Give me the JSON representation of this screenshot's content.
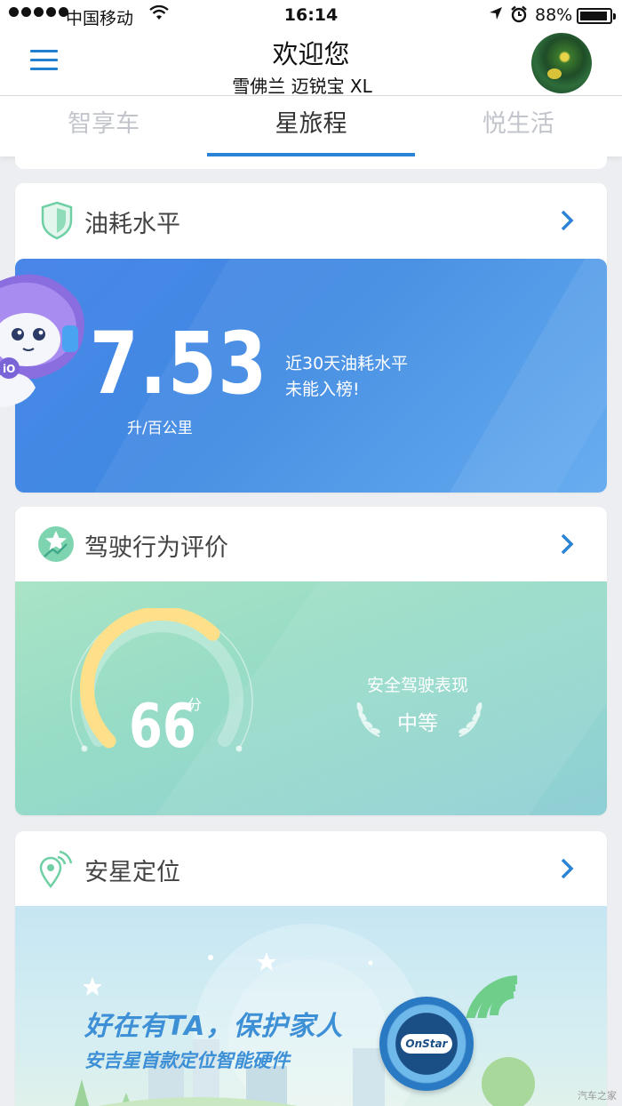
{
  "status_bar": {
    "carrier": "中国移动",
    "time": "16:14",
    "battery_pct": "88%",
    "battery_level": 0.88,
    "icons": [
      "signal-dots-icon",
      "wifi-icon",
      "location-arrow-icon",
      "alarm-icon",
      "battery-icon"
    ]
  },
  "header": {
    "title": "欢迎您",
    "subtitle": "雪佛兰 迈锐宝 XL"
  },
  "tabs": [
    {
      "label": "智享车",
      "active": false
    },
    {
      "label": "星旅程",
      "active": true
    },
    {
      "label": "悦生活",
      "active": false
    }
  ],
  "fuel_card": {
    "title": "油耗水平",
    "value": "7.53",
    "unit": "升/百公里",
    "note_line1": "近30天油耗水平",
    "note_line2": "未能入榜!",
    "accent": "#4a86e8"
  },
  "drive_card": {
    "title": "驾驶行为评价",
    "score": "66",
    "score_unit": "分",
    "score_fraction": 0.66,
    "rating_label": "安全驾驶表现",
    "rating_value": "中等"
  },
  "onstar_card": {
    "title": "安星定位",
    "promo_title": "好在有TA，保护家人",
    "promo_sub": "安吉星首款定位智能硬件",
    "device_logo": "OnStar"
  },
  "watermark": "汽车之家",
  "colors": {
    "brand_blue": "#2b83d5",
    "gauge_yellow": "#fde089",
    "card_green": "#97dcc6"
  }
}
